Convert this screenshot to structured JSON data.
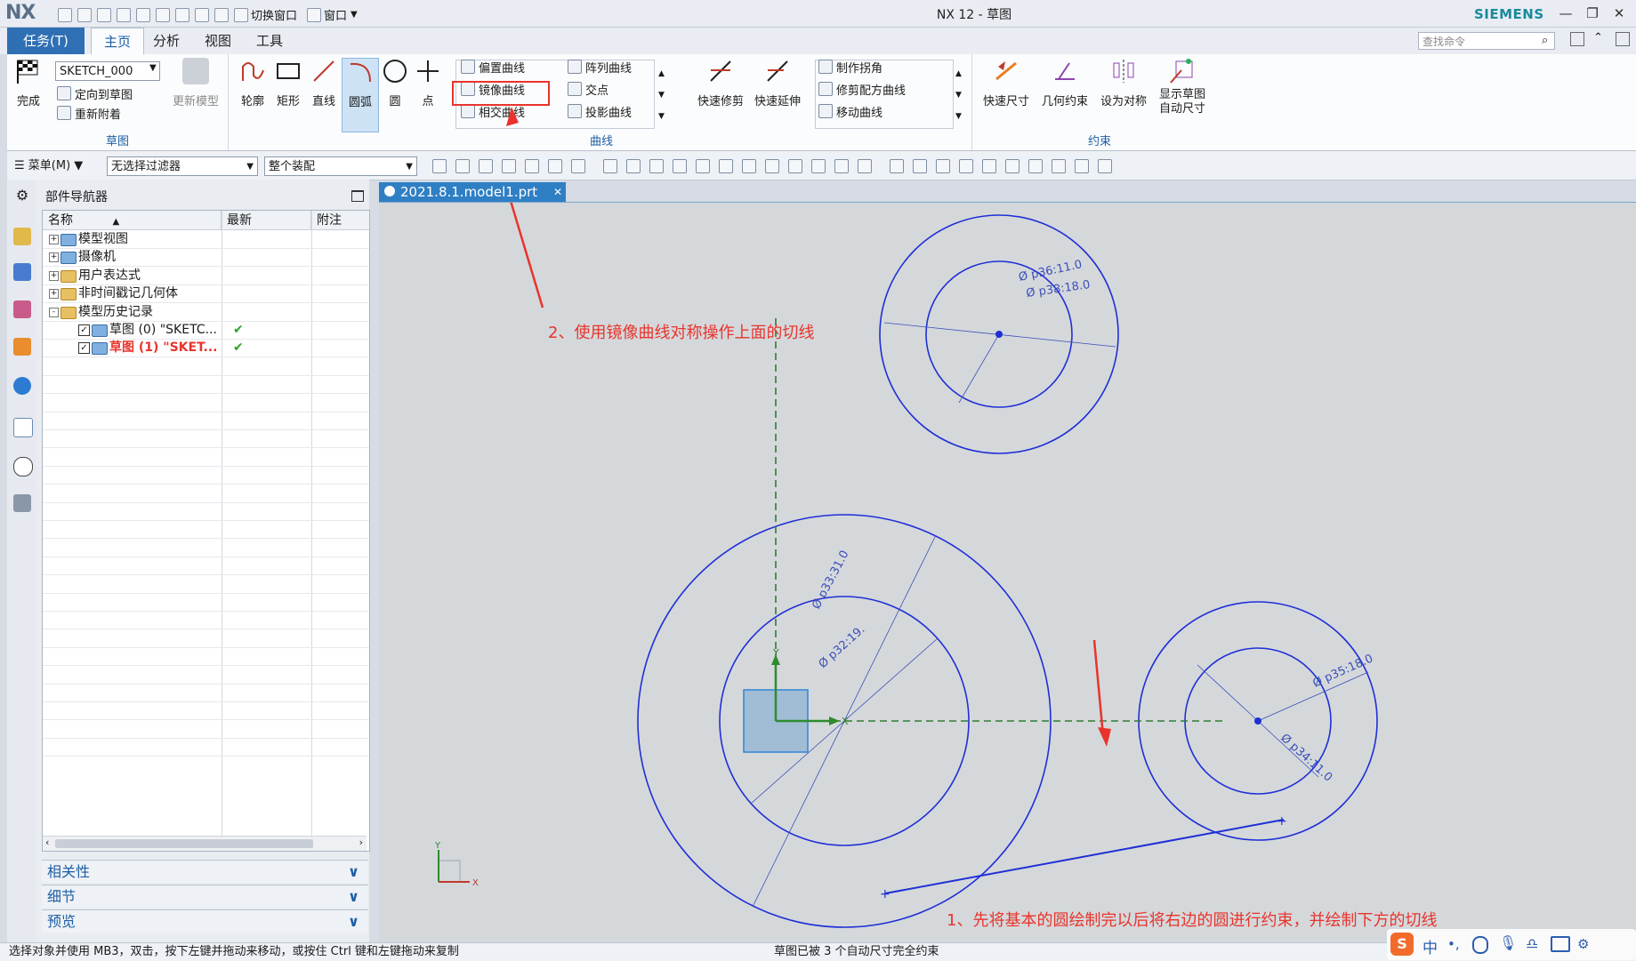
{
  "app": {
    "logo": "NX",
    "window_title": "NX 12 - 草图",
    "brand": "SIEMENS",
    "quick_access": [
      "切换窗口",
      "窗口"
    ]
  },
  "ribbon_tabs": [
    "任务(T)",
    "主页",
    "分析",
    "视图",
    "工具"
  ],
  "search": {
    "placeholder": "查找命令"
  },
  "ribbon": {
    "sketch_group": {
      "finish": "完成",
      "sketch_name": "SKETCH_000",
      "orient": "定向到草图",
      "reattach": "重新附着",
      "update_model": "更新模型",
      "label": "草图"
    },
    "curve_group": {
      "profile": "轮廓",
      "rectangle": "矩形",
      "line": "直线",
      "arc": "圆弧",
      "circle": "圆",
      "point": "点",
      "offset_curve": "偏置曲线",
      "pattern_curve": "阵列曲线",
      "mirror_curve": "镜像曲线",
      "intersection_point": "交点",
      "intersection_curve": "相交曲线",
      "project_curve": "投影曲线",
      "quick_trim": "快速修剪",
      "quick_extend": "快速延伸",
      "make_corner": "制作拐角",
      "modify_fillet": "修剪配方曲线",
      "move_curve": "移动曲线",
      "label": "曲线"
    },
    "constraint_group": {
      "rapid_dimension": "快速尺寸",
      "geometric_constraint": "几何约束",
      "make_symmetric": "设为对称",
      "show_auto_dims": "显示草图自动尺寸",
      "label": "约束"
    }
  },
  "toolbar2": {
    "menu": "菜单(M)",
    "filter": "无选择过滤器",
    "assembly": "整个装配"
  },
  "navigator": {
    "title": "部件导航器",
    "columns": [
      "名称",
      "最新",
      "附注"
    ],
    "rows": [
      {
        "label": "模型视图",
        "icon": "model-view-icon"
      },
      {
        "label": "摄像机",
        "icon": "camera-icon"
      },
      {
        "label": "用户表达式",
        "icon": "folder-icon"
      },
      {
        "label": "非时间戳记几何体",
        "icon": "folder-icon"
      },
      {
        "label": "模型历史记录",
        "icon": "folder-icon"
      },
      {
        "label": "草图 (0) \"SKETC...",
        "icon": "sketch-icon",
        "latest": "✔"
      },
      {
        "label": "草图 (1) \"SKET...",
        "icon": "sketch-icon",
        "latest": "✔",
        "active": true
      }
    ],
    "panels": [
      "相关性",
      "细节",
      "预览"
    ]
  },
  "graphics": {
    "tab_title": "2021.8.1.model1.prt",
    "dims": [
      "Ø p36:11.0",
      "Ø p38:18.0",
      "Ø p33:31.0",
      "Ø p32:19.",
      "Ø p35:18.0",
      "Ø p34:11.0"
    ],
    "annotation_top": "2、使用镜像曲线对称操作上面的切线",
    "annotation_bottom": "1、先将基本的圆绘制完以后将右边的圆进行约束，并绘制下方的切线",
    "axis_x": "X",
    "axis_y": "Y",
    "colors": {
      "curve": "#1f2fd6",
      "annotation": "#e8342c",
      "dim": "#3a4fb8",
      "axis_dash": "#2e7d32"
    }
  },
  "status": {
    "left": "选择对象并使用 MB3，双击，按下左键并拖动来移动，或按住 Ctrl 键和左键拖动来复制",
    "center": "草图已被 3 个自动尺寸完全约束"
  },
  "ime": {
    "lang": "中"
  }
}
